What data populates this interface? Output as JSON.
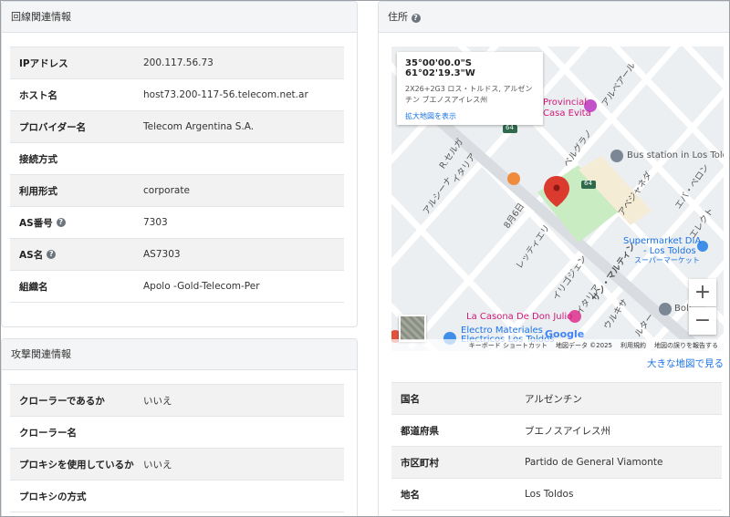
{
  "line_info": {
    "title": "回線関連情報",
    "rows": [
      {
        "label": "IPアドレス",
        "value": "200.117.56.73",
        "help": false
      },
      {
        "label": "ホスト名",
        "value": "host73.200-117-56.telecom.net.ar",
        "help": false
      },
      {
        "label": "プロバイダー名",
        "value": "Telecom Argentina S.A.",
        "help": false
      },
      {
        "label": "接続方式",
        "value": "",
        "help": false
      },
      {
        "label": "利用形式",
        "value": "corporate",
        "help": false
      },
      {
        "label": "AS番号",
        "value": "7303",
        "help": true
      },
      {
        "label": "AS名",
        "value": "AS7303",
        "help": true
      },
      {
        "label": "組織名",
        "value": "Apolo -Gold-Telecom-Per",
        "help": false
      }
    ]
  },
  "attack_info": {
    "title": "攻撃関連情報",
    "rows": [
      {
        "label": "クローラーであるか",
        "value": "いいえ"
      },
      {
        "label": "クローラー名",
        "value": ""
      },
      {
        "label": "プロキシを使用しているか",
        "value": "いいえ"
      },
      {
        "label": "プロキシの方式",
        "value": ""
      }
    ]
  },
  "address": {
    "title": "住所",
    "map": {
      "info_window": {
        "coords": "35°00'00.0\"S 61°02'19.3\"W",
        "address_line1": "2X26+2G3 ロス・トルドス, アルゼン",
        "address_line2": "チン ブエノスアイレス州",
        "link": "拡大地図を表示"
      },
      "labels": {
        "provincial": "Provincial",
        "casa_evita": "Casa Evita",
        "bus_station": "Bus station in Los Toldo",
        "supermarket1": "Supermarket DIA",
        "supermarket2": "- Los Toldos",
        "supermarket3": "スーパーマーケット",
        "casona": "La Casona De Don Julio",
        "electro1": "Electro Materiales",
        "electro2": "Electricos Los Toldos",
        "boli": "Boli",
        "route": "64",
        "street_r": "R.セルガ",
        "street_italia": "イタリア",
        "street_arcina": "アルシーナ",
        "street_8": "8月6日",
        "street_lettier": "レッティエリ",
        "street_irigoyen": "イリゴジェン",
        "street_martin": "サン・マルティン",
        "street_avellaneda": "アベジャネダ",
        "street_evaperon": "エバ・ペロン",
        "street_belgrano": "ベルグラノ",
        "street_alvear": "アルベアール",
        "street_urquiza": "ウルキサ",
        "street_electo": "エレクト",
        "street_ruta": "ルター",
        "street_italia2": "イタリア"
      },
      "zoom_in": "+",
      "zoom_out": "−",
      "google": "Google",
      "footer": {
        "shortcut": "キーボード ショートカット",
        "mapdata": "地図データ ©2025",
        "terms": "利用規約",
        "report": "地図の誤りを報告する"
      }
    },
    "big_map_link": "大きな地図で見る",
    "rows": [
      {
        "label": "国名",
        "value": "アルゼンチン"
      },
      {
        "label": "都道府県",
        "value": "ブエノスアイレス州"
      },
      {
        "label": "市区町村",
        "value": "Partido de General Viamonte"
      },
      {
        "label": "地名",
        "value": "Los Toldos"
      }
    ]
  },
  "colors": {
    "link_blue": "#1a73e8",
    "pin_red": "#db3a2e",
    "park_green": "#c9ecc2"
  },
  "help_icon": "question-circle-icon"
}
